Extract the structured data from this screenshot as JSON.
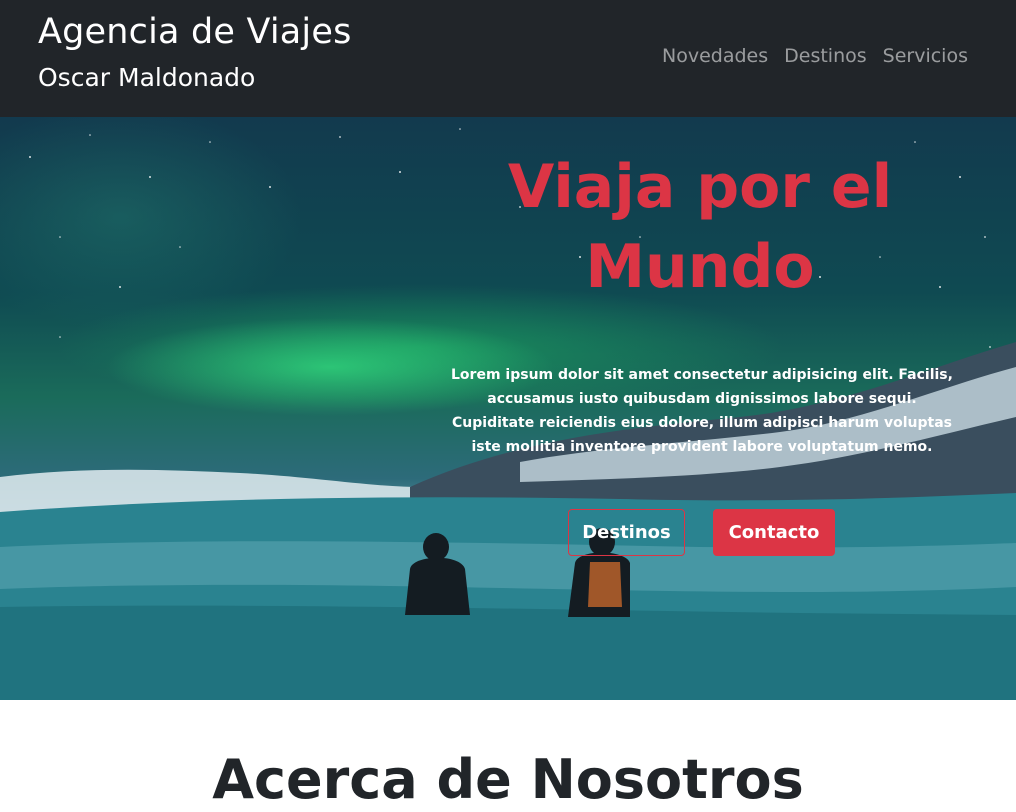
{
  "header": {
    "title": "Agencia de Viajes",
    "subtitle": "Oscar Maldonado",
    "nav": [
      {
        "label": "Novedades"
      },
      {
        "label": "Destinos"
      },
      {
        "label": "Servicios"
      }
    ]
  },
  "hero": {
    "heading_line1": "Viaja por el",
    "heading_line2": "Mundo",
    "text": "Lorem ipsum dolor sit amet consectetur adipisicing elit. Facilis, accusamus iusto quibusdam dignissimos labore sequi. Cupiditate reiciendis eius dolore, illum adipisci harum voluptas iste mollitia inventore provident labore voluptatum nemo.",
    "buttons": {
      "destinos": "Destinos",
      "contacto": "Contacto"
    },
    "image_description_icon": "aurora-landscape-image"
  },
  "about": {
    "title": "Acerca de Nosotros"
  },
  "colors": {
    "navbar_bg": "#212529",
    "accent": "#dc3545",
    "nav_link": "rgba(255,255,255,0.55)"
  }
}
